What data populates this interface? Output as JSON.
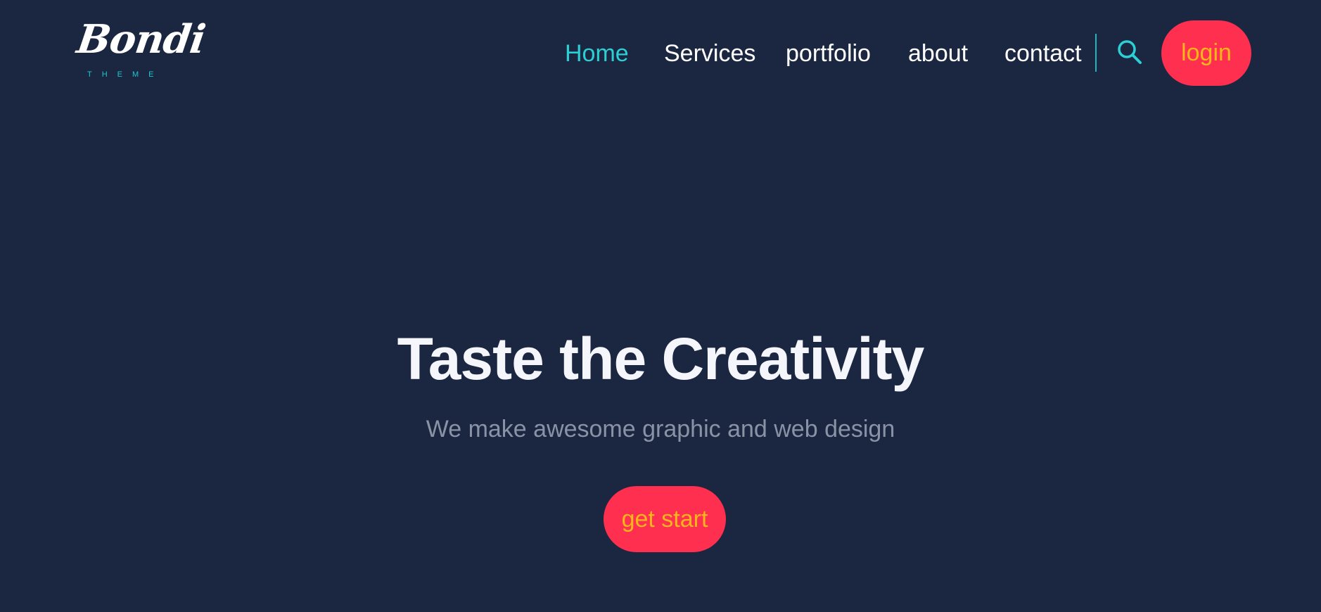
{
  "logo": {
    "wordmark": "Bondi",
    "tagline": "THEME"
  },
  "nav": {
    "items": [
      {
        "label": "Home",
        "active": true
      },
      {
        "label": "Services",
        "active": false
      },
      {
        "label": "portfolio",
        "active": false
      },
      {
        "label": "about",
        "active": false
      },
      {
        "label": "contact",
        "active": false
      }
    ],
    "search_icon": "search-icon",
    "login_label": "login"
  },
  "hero": {
    "title": "Taste the Creativity",
    "subtitle": "We make awesome graphic and web design",
    "cta_label": "get start"
  },
  "colors": {
    "background": "#1b2741",
    "accent_cyan": "#2ccfd3",
    "button_red": "#ff2f4f",
    "button_text": "#f7b51b"
  }
}
